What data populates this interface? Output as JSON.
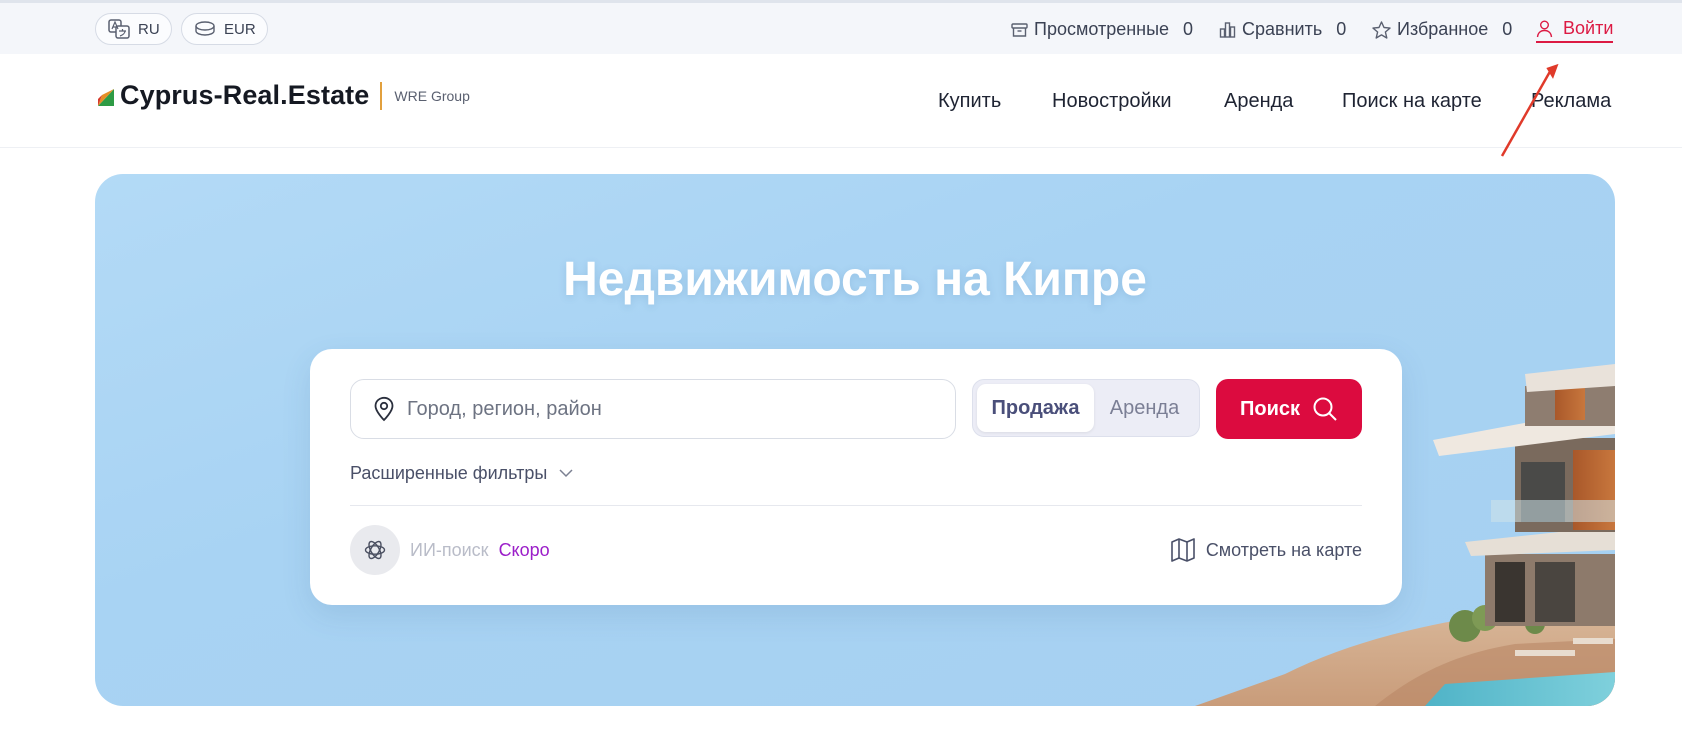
{
  "topbar": {
    "language": "RU",
    "currency": "EUR",
    "viewed": {
      "label": "Просмотренные",
      "count": "0"
    },
    "compare": {
      "label": "Сравнить",
      "count": "0"
    },
    "favorites": {
      "label": "Избранное",
      "count": "0"
    },
    "login": "Войти"
  },
  "header": {
    "logo_name": "Cyprus-Real.Estate",
    "logo_sub": "WRE Group",
    "nav": [
      "Купить",
      "Новостройки",
      "Аренда",
      "Поиск на карте",
      "Реклама"
    ]
  },
  "hero": {
    "title": "Недвижимость на Кипре",
    "location_placeholder": "Город, регион, район",
    "deal_options": [
      "Продажа",
      "Аренда"
    ],
    "search_label": "Поиск",
    "filters_label": "Расширенные фильтры",
    "ai_label": "ИИ-поиск",
    "ai_soon": "Скоро",
    "map_label": "Смотреть на карте"
  },
  "colors": {
    "accent": "#dc0b3f",
    "login": "#dc1a43",
    "hero_bg": "#a8d3f3",
    "soon": "#9b1ec9"
  }
}
